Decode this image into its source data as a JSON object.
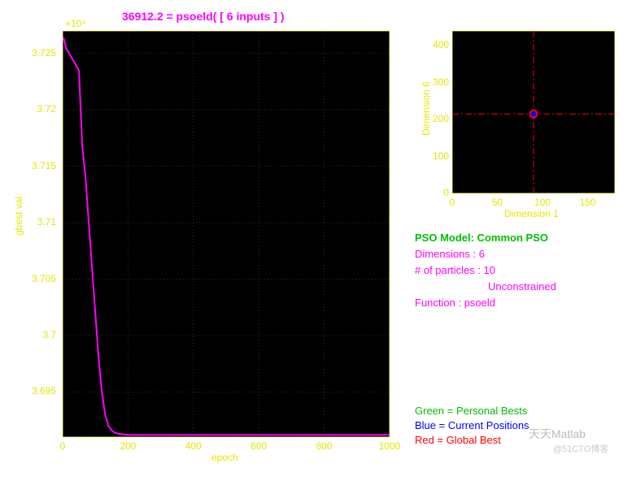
{
  "chart_data": [
    {
      "type": "line",
      "title": "36912.2 = psoeld( [ 6 inputs ] )",
      "xlabel": "epoch",
      "ylabel": "gbest val.",
      "y_multiplier_text": "×10⁴",
      "xlim": [
        0,
        1000
      ],
      "ylim": [
        3.691,
        3.727
      ],
      "xticks": [
        0,
        200,
        400,
        600,
        800,
        1000
      ],
      "yticks": [
        3.695,
        3.7,
        3.705,
        3.71,
        3.715,
        3.72,
        3.725
      ],
      "series": [
        {
          "name": "gbest",
          "color": "#ff00ff",
          "x": [
            0,
            5,
            10,
            20,
            30,
            40,
            50,
            60,
            70,
            80,
            90,
            100,
            110,
            120,
            130,
            140,
            150,
            160,
            170,
            200,
            300,
            500,
            1000
          ],
          "y_e4": [
            3.7265,
            3.7262,
            3.7255,
            3.725,
            3.7245,
            3.724,
            3.7235,
            3.7168,
            3.714,
            3.71,
            3.706,
            3.702,
            3.698,
            3.695,
            3.693,
            3.692,
            3.6916,
            3.6914,
            3.6913,
            3.6912,
            3.6912,
            3.6912,
            3.6912
          ]
        }
      ]
    },
    {
      "type": "scatter",
      "xlabel": "Dimension 1",
      "ylabel": "Dimension 6",
      "xlim": [
        0,
        180
      ],
      "ylim": [
        0,
        440
      ],
      "xticks": [
        0,
        50,
        100,
        150
      ],
      "yticks": [
        0,
        100,
        200,
        300,
        400
      ],
      "crosshair": {
        "x": 90,
        "y": 215,
        "color": "#ff0000"
      },
      "points": [
        {
          "name": "global-best",
          "x": 90,
          "y": 215,
          "color": "#ff0000",
          "r": 5
        },
        {
          "name": "current-pos",
          "x": 90,
          "y": 215,
          "color": "#0000ff",
          "r": 3
        }
      ]
    }
  ],
  "info": {
    "model_label": "PSO Model: Common PSO",
    "dimensions": "Dimensions : 6",
    "particles": "# of particles : 10",
    "constraint": "Unconstrained",
    "function": "Function : psoeld"
  },
  "legend": {
    "green": "Green = Personal Bests",
    "blue": "Blue  = Current Positions",
    "red": "Red   = Global Best"
  },
  "watermark": {
    "main": "天天Matlab",
    "sub": "@51CTO博客"
  }
}
